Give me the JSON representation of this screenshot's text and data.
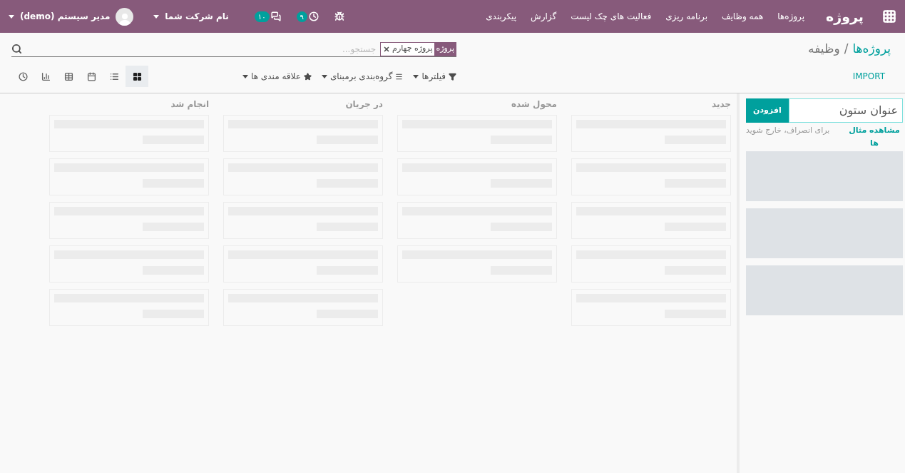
{
  "navbar": {
    "brand": "پروژه",
    "menu": [
      "پروژه‌ها",
      "همه وظایف",
      "برنامه ریزی",
      "فعالیت های چک لیست",
      "گزارش",
      "پیکربندی"
    ],
    "systray": [
      {
        "kind": "debug"
      },
      {
        "kind": "activity",
        "badge": "۹"
      },
      {
        "kind": "messages",
        "badge": "۱۰"
      }
    ],
    "company": "نام شرکت شما",
    "user": "مدیر سیستم (demo)"
  },
  "breadcrumb": [
    {
      "label": "پروژه‌ها",
      "selected": false
    },
    {
      "label": "وظیفه",
      "selected": true
    }
  ],
  "breadcrumb_separator": "/",
  "search": {
    "facets": [
      {
        "field": "پروژه",
        "value": "پروژه چهارم"
      }
    ],
    "placeholder": "جستجو..."
  },
  "import_button": "IMPORT",
  "filter_menus": [
    {
      "kind": "filter",
      "label": "فیلترها"
    },
    {
      "kind": "group",
      "label": "گروه‌بندی برمبنای"
    },
    {
      "kind": "favorite",
      "label": "علاقه مندی ها"
    }
  ],
  "views": [
    {
      "kind": "kanban",
      "selected": true
    },
    {
      "kind": "list",
      "selected": false
    },
    {
      "kind": "calendar",
      "selected": false
    },
    {
      "kind": "pivot",
      "selected": false
    },
    {
      "kind": "graph",
      "selected": false
    },
    {
      "kind": "activity",
      "selected": false
    }
  ],
  "quick_create": {
    "value": "عنوان ستون",
    "button": "افزودن",
    "examples_link": "مشاهده مثال ها",
    "hint": "برای انصراف، خارج شوید",
    "ghosts": [
      {
        "kind": "placeholder"
      },
      {
        "kind": "placeholder"
      },
      {
        "kind": "placeholder"
      }
    ]
  },
  "columns": [
    {
      "title": "جدید",
      "cards": [
        {
          "kind": "placeholder"
        },
        {
          "kind": "placeholder"
        },
        {
          "kind": "placeholder"
        },
        {
          "kind": "placeholder"
        },
        {
          "kind": "placeholder"
        }
      ]
    },
    {
      "title": "محول شده",
      "cards": [
        {
          "kind": "placeholder"
        },
        {
          "kind": "placeholder"
        },
        {
          "kind": "placeholder"
        },
        {
          "kind": "placeholder"
        }
      ]
    },
    {
      "title": "در جریان",
      "cards": [
        {
          "kind": "placeholder"
        },
        {
          "kind": "placeholder"
        },
        {
          "kind": "placeholder"
        },
        {
          "kind": "placeholder"
        },
        {
          "kind": "placeholder"
        }
      ]
    },
    {
      "title": "انجام شد",
      "cards": [
        {
          "kind": "placeholder"
        },
        {
          "kind": "placeholder"
        },
        {
          "kind": "placeholder"
        },
        {
          "kind": "placeholder"
        },
        {
          "kind": "placeholder"
        }
      ]
    }
  ]
}
